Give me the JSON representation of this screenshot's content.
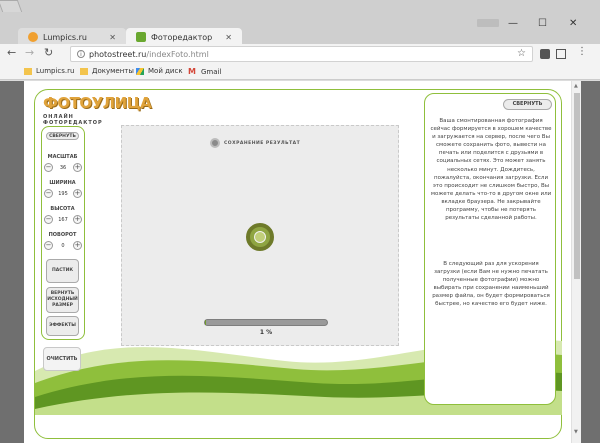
{
  "browser": {
    "tabs": [
      {
        "label": "Lumpics.ru",
        "icon": "lumpics-favicon",
        "color": "#f0a030"
      },
      {
        "label": "Фоторедактор",
        "icon": "fotoulitsa-favicon",
        "color": "#6aa830"
      }
    ],
    "url_host": "photostreet.ru",
    "url_path": "/indexFoto.html",
    "bookmarks": [
      {
        "label": "Lumpics.ru",
        "icon": "folder-icon"
      },
      {
        "label": "Документы",
        "icon": "folder-icon"
      },
      {
        "label": "Мой диск",
        "icon": "google-drive-icon"
      },
      {
        "label": "Gmail",
        "icon": "gmail-icon"
      }
    ]
  },
  "app": {
    "logo_main": "ФОТОУЛИЦА",
    "logo_sub": "ОНЛАЙН ФОТОРЕДАКТОР",
    "collapse_label": "СВЕРНУТЬ",
    "controls": [
      {
        "label": "МАСШТАБ",
        "value": "36"
      },
      {
        "label": "ШИРИНА",
        "value": "195"
      },
      {
        "label": "ВЫСОТА",
        "value": "167"
      },
      {
        "label": "ПОВОРОТ",
        "value": "0"
      }
    ],
    "buttons": {
      "paste": "ПАСТИК",
      "restore": "ВЕРНУТЬ ИСХОДНЫЙ РАЗМЕР",
      "effects": "ЭФФЕКТЫ",
      "clear": "ОЧИСТИТЬ"
    },
    "saving_label": "СОХРАНЕНИЕ РЕЗУЛЬТАТ",
    "progress": 0.01,
    "percent_text": "1 %",
    "panel_collapse": "СВЕРНУТЬ",
    "info_text_1": "Ваша смонтированная фотография сейчас формируется в хорошем качестве и загружается на сервер, после чего Вы сможете сохранить фото, вывести на печать или поделится с друзьями в социальных сетях. Это может занять несколько минут. Дождитесь, пожалуйста, окончания загрузки. Если это происходит не слишком быстро, Вы можете делать что-то в другом окне или вкладке браузера. Не закрывайте программу, чтобы не потерять результаты сделанной работы.",
    "info_text_2": "В следующий раз для ускорения загрузки (если Вам не нужно печатать полученные фотографии) можно выбирать при сохранении наименьший размер файла, он будет формироваться быстрее, но качество его будет ниже."
  }
}
